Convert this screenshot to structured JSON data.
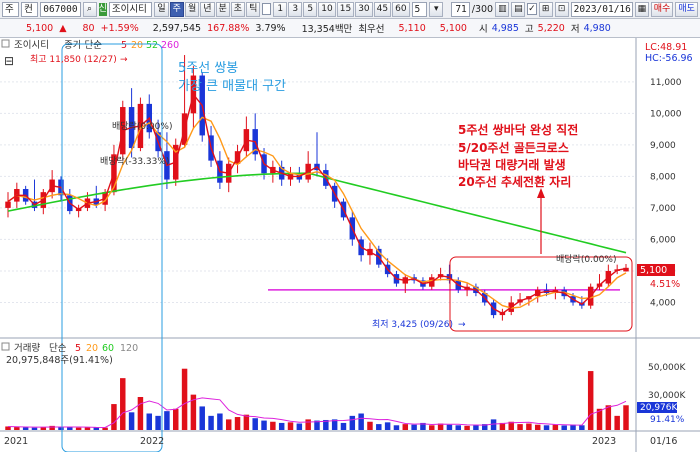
{
  "toolbar": {
    "market": "주",
    "ctrl": "컨",
    "code": "067000",
    "search_icon": "search-icon",
    "sin": "신",
    "name": "조이시티",
    "periods": [
      "일",
      "주",
      "월",
      "년",
      "분",
      "초",
      "틱"
    ],
    "selected_period": "주",
    "intervals": [
      "1",
      "3",
      "5",
      "10",
      "15",
      "30",
      "45",
      "60"
    ],
    "interval_value": "5",
    "count_value": "71",
    "count_total": "/300",
    "date": "2023/01/16",
    "buy_label": "매수",
    "sell_label": "매도"
  },
  "quote": {
    "price": "5,100",
    "change": "80",
    "change_pct": "+1.59%",
    "volume": "2,597,545",
    "vol_ratio": "167.88%",
    "turnover": "3.79%",
    "amount": "13,354백만",
    "best_label": "최우선",
    "best_ask": "5,110",
    "best_bid": "5,100",
    "open_label": "시",
    "open": "4,985",
    "high_label": "고",
    "high": "5,220",
    "low_label": "저",
    "low": "4,980"
  },
  "chart": {
    "legend_name": "조이시티",
    "legend_title": "종가 단순",
    "ma_periods": [
      "5",
      "20",
      "52",
      "260"
    ],
    "lc": "LC:48.91",
    "hc": "HC:-56.96",
    "high_label": "최고 11,850 (12/27)",
    "low_label": "최저 3,425 (09/26)",
    "rights_labels": [
      "배당락(0.00%)",
      "배당락(-33.33%)",
      "배당락(0.00%)"
    ],
    "y_ticks": [
      "11,000",
      "10,000",
      "9,000",
      "8,000",
      "7,000",
      "6,000",
      "5,000",
      "4,000"
    ],
    "price_tag": "5,100",
    "pct_tag": "4.51%",
    "note_left": [
      "5주선 쌍봉",
      "가장 큰 매물대 구간"
    ],
    "note_right": [
      "5주선 쌍바닥 완성 직전",
      "5/20주선 골든크로스",
      "바닥권 대량거래 발생",
      "20주선 추세전환 자리"
    ],
    "x_labels": [
      "2021",
      "2022",
      "2023",
      "01/16"
    ]
  },
  "volume_panel": {
    "title": "거래량",
    "ma_title": "단순",
    "ma_periods": [
      "5",
      "20",
      "60",
      "120"
    ],
    "info": "20,975,848주(91.41%)",
    "y_ticks": [
      "50,000K",
      "30,000K"
    ],
    "vol_tag": "20,976K",
    "pct_tag": "91.41%"
  },
  "colors": {
    "up": "#e0101a",
    "down": "#1a36d8",
    "ma5": "#e0101a",
    "ma20": "#ff9a1a",
    "ma52": "#22cc22",
    "ma260": "#dd22dd",
    "note_blue": "#2a9de0"
  },
  "chart_data": {
    "type": "candlestick",
    "candles": [
      [
        7.0,
        7.5,
        6.7,
        7.2
      ],
      [
        7.2,
        7.8,
        7.0,
        7.6
      ],
      [
        7.6,
        7.7,
        7.1,
        7.2
      ],
      [
        7.2,
        7.9,
        6.9,
        7.0
      ],
      [
        7.0,
        7.6,
        6.8,
        7.5
      ],
      [
        7.5,
        8.2,
        7.3,
        7.9
      ],
      [
        7.9,
        8.0,
        7.2,
        7.4
      ],
      [
        7.4,
        7.6,
        6.8,
        6.9
      ],
      [
        6.9,
        7.1,
        6.7,
        7.0
      ],
      [
        7.0,
        7.5,
        6.9,
        7.3
      ],
      [
        7.3,
        7.7,
        7.0,
        7.1
      ],
      [
        7.1,
        7.6,
        6.9,
        7.5
      ],
      [
        7.5,
        9.0,
        7.4,
        8.7
      ],
      [
        8.7,
        10.4,
        8.5,
        10.2
      ],
      [
        10.2,
        10.8,
        8.6,
        8.9
      ],
      [
        8.9,
        10.5,
        8.8,
        10.3
      ],
      [
        10.3,
        10.6,
        9.2,
        9.4
      ],
      [
        9.4,
        9.8,
        8.6,
        8.8
      ],
      [
        8.8,
        9.4,
        7.6,
        7.9
      ],
      [
        7.9,
        9.2,
        7.7,
        9.0
      ],
      [
        9.0,
        11.85,
        8.9,
        10.0
      ],
      [
        10.0,
        11.5,
        9.5,
        11.2
      ],
      [
        11.2,
        11.3,
        9.1,
        9.3
      ],
      [
        9.3,
        9.6,
        8.3,
        8.5
      ],
      [
        8.5,
        8.8,
        7.6,
        7.8
      ],
      [
        7.8,
        8.6,
        7.5,
        8.4
      ],
      [
        8.4,
        9.0,
        8.1,
        8.8
      ],
      [
        8.8,
        9.9,
        8.6,
        9.5
      ],
      [
        9.5,
        10.0,
        8.5,
        8.7
      ],
      [
        8.7,
        8.9,
        7.9,
        8.1
      ],
      [
        8.1,
        8.5,
        7.8,
        8.3
      ],
      [
        8.3,
        8.5,
        7.7,
        7.9
      ],
      [
        7.9,
        8.3,
        7.7,
        8.1
      ],
      [
        8.1,
        8.3,
        7.8,
        7.9
      ],
      [
        7.9,
        8.8,
        7.8,
        8.4
      ],
      [
        8.4,
        9.4,
        8.0,
        8.2
      ],
      [
        8.2,
        8.4,
        7.6,
        7.7
      ],
      [
        7.7,
        7.8,
        7.0,
        7.2
      ],
      [
        7.2,
        7.3,
        6.6,
        6.7
      ],
      [
        6.7,
        6.9,
        5.8,
        6.0
      ],
      [
        6.0,
        6.1,
        5.3,
        5.5
      ],
      [
        5.5,
        5.9,
        5.2,
        5.7
      ],
      [
        5.7,
        5.8,
        5.1,
        5.2
      ],
      [
        5.2,
        5.4,
        4.8,
        4.9
      ],
      [
        4.9,
        5.0,
        4.5,
        4.6
      ],
      [
        4.6,
        4.9,
        4.3,
        4.8
      ],
      [
        4.8,
        4.9,
        4.6,
        4.7
      ],
      [
        4.7,
        4.8,
        4.4,
        4.5
      ],
      [
        4.5,
        4.9,
        4.4,
        4.8
      ],
      [
        4.8,
        5.1,
        4.7,
        4.9
      ],
      [
        4.9,
        5.2,
        4.6,
        4.7
      ],
      [
        4.7,
        4.8,
        4.3,
        4.4
      ],
      [
        4.4,
        4.6,
        4.2,
        4.5
      ],
      [
        4.5,
        4.6,
        4.2,
        4.3
      ],
      [
        4.3,
        4.4,
        3.9,
        4.0
      ],
      [
        4.0,
        4.1,
        3.5,
        3.6
      ],
      [
        3.6,
        3.8,
        3.425,
        3.7
      ],
      [
        3.7,
        4.2,
        3.6,
        4.0
      ],
      [
        4.0,
        4.3,
        3.9,
        4.1
      ],
      [
        4.1,
        4.2,
        3.9,
        4.2
      ],
      [
        4.2,
        4.5,
        4.0,
        4.4
      ],
      [
        4.4,
        4.6,
        4.2,
        4.3
      ],
      [
        4.3,
        4.5,
        4.1,
        4.4
      ],
      [
        4.4,
        4.5,
        4.1,
        4.2
      ],
      [
        4.2,
        4.3,
        3.9,
        4.0
      ],
      [
        4.0,
        4.2,
        3.8,
        3.9
      ],
      [
        3.9,
        4.6,
        3.8,
        4.5
      ],
      [
        4.5,
        4.9,
        4.4,
        4.6
      ],
      [
        4.6,
        5.2,
        4.5,
        5.0
      ],
      [
        5.0,
        5.2,
        4.9,
        5.05
      ],
      [
        4.985,
        5.22,
        4.98,
        5.1
      ]
    ],
    "volume_k": [
      3000,
      2500,
      2200,
      2000,
      2400,
      3500,
      2600,
      2200,
      2000,
      2100,
      2300,
      2000,
      22000,
      44000,
      15000,
      28000,
      14000,
      12000,
      16000,
      18000,
      52000,
      30000,
      20000,
      12000,
      14000,
      9000,
      11000,
      13000,
      10000,
      8000,
      7000,
      6000,
      6500,
      5500,
      9000,
      8000,
      8500,
      9000,
      6000,
      12000,
      14000,
      7000,
      5000,
      6500,
      4000,
      5000,
      4500,
      6000,
      4000,
      5500,
      4500,
      4000,
      3500,
      3800,
      5000,
      9000,
      6000,
      7000,
      5000,
      5500,
      4500,
      4000,
      4500,
      3800,
      4500,
      4000,
      50000,
      18000,
      20976,
      12000,
      20976
    ],
    "ylim": [
      3000,
      12200
    ],
    "y_ticks": [
      11000,
      10000,
      9000,
      8000,
      7000,
      6000,
      5000,
      4000
    ],
    "resistance_line": 4400
  }
}
